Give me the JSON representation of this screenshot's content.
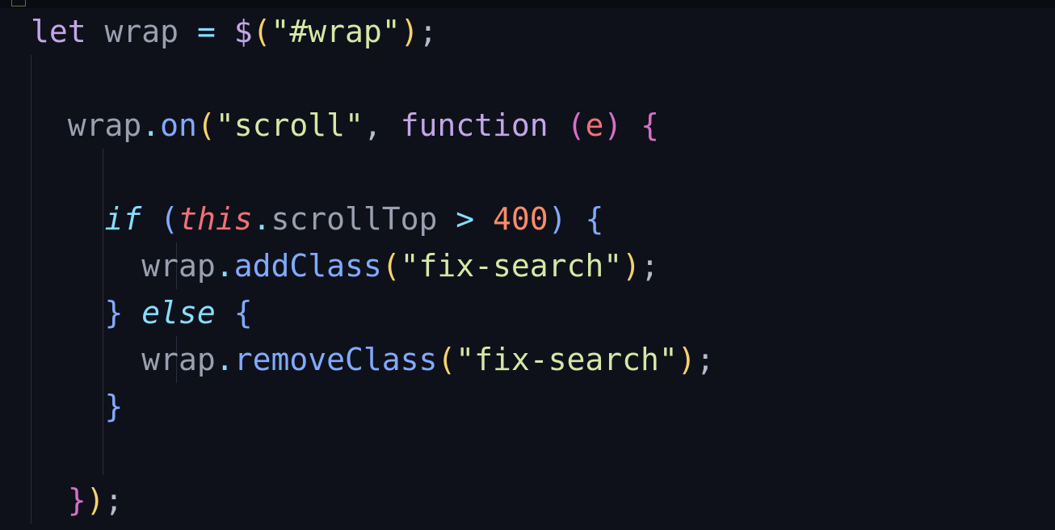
{
  "code": {
    "line1": {
      "kw": "let",
      "var": "wrap",
      "op": "=",
      "dollar": "$",
      "str": "\"#wrap\""
    },
    "line3": {
      "obj": "wrap",
      "method": "on",
      "str": "\"scroll\"",
      "func_kw": "function",
      "param": "e"
    },
    "line5": {
      "if_kw": "if",
      "this_kw": "this",
      "prop": "scrollTop",
      "op": ">",
      "num": "400"
    },
    "line6": {
      "obj": "wrap",
      "method": "addClass",
      "str": "\"fix-search\""
    },
    "line7": {
      "else_kw": "else"
    },
    "line8": {
      "obj": "wrap",
      "method": "removeClass",
      "str": "\"fix-search\""
    }
  },
  "colors": {
    "background": "#0f111a",
    "keyword": "#c3a6e8",
    "string": "#d5e8a6",
    "function": "#82aaff",
    "number": "#f78c6c",
    "this": "#f07178"
  }
}
